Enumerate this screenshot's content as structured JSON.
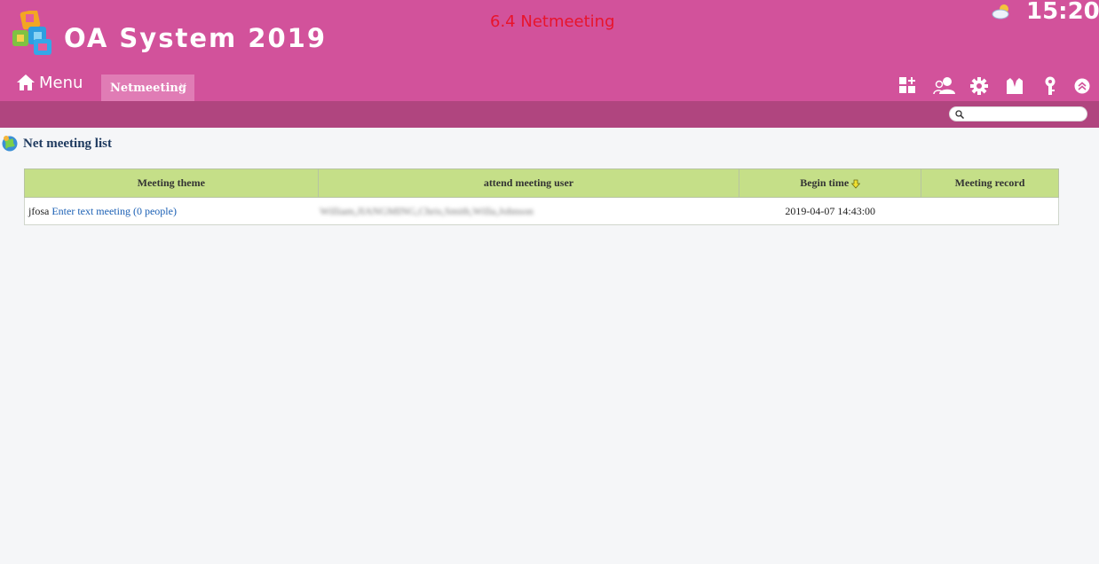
{
  "header": {
    "app_title": "OA System 2019",
    "annotation": "6.4 Netmeeting",
    "clock": "15:20",
    "menu_label": "Menu"
  },
  "tabs": [
    {
      "label": "Netmeeting",
      "close": "×"
    }
  ],
  "toolbar_icons": [
    "add-widget-icon",
    "users-icon",
    "gear-icon",
    "shirt-icon",
    "key-icon",
    "collapse-up-icon"
  ],
  "search": {
    "placeholder": ""
  },
  "page": {
    "title": "Net meeting list"
  },
  "table": {
    "columns": [
      "Meeting theme",
      "attend meeting user",
      "Begin time",
      "Meeting record"
    ],
    "rows": [
      {
        "theme": "jfosa",
        "link": "Enter text meeting (0 people)",
        "users": "William,JIANGMING,Chris,Smith,Willa,Johnson",
        "begin_time": "2019-04-07 14:43:00",
        "record": ""
      }
    ]
  },
  "colors": {
    "header": "#d2529b",
    "subbar": "#b0457f",
    "tab": "#e07cb5",
    "table_header": "#c5df88",
    "annotation": "#e8142c",
    "link": "#1a5fb4"
  }
}
